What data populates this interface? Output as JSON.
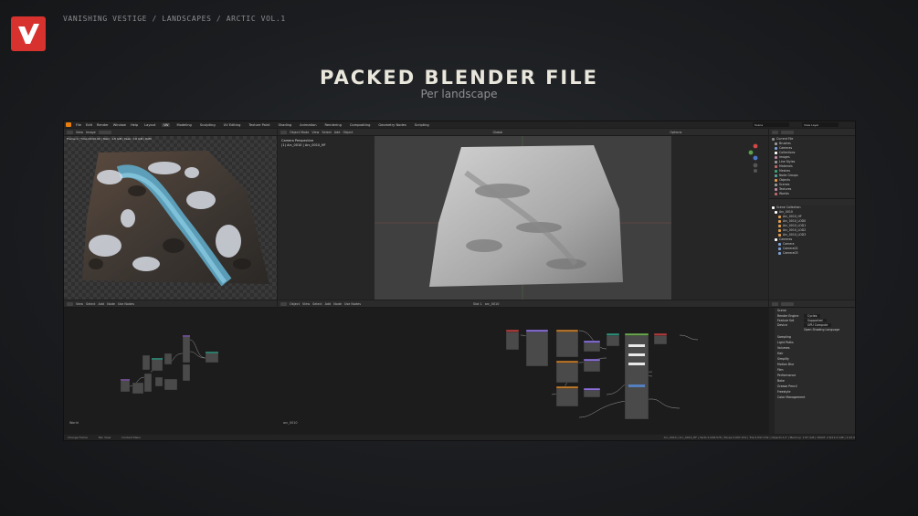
{
  "header": {
    "breadcrumb": "VANISHING VESTIGE / LANDSCAPES / ARCTIC VOL.1",
    "title": "PACKED BLENDER FILE",
    "subtitle": "Per landscape"
  },
  "colors": {
    "brand": "#d8322f",
    "blender_orange": "#e87d0d",
    "node_purple": "#8a6fd8",
    "node_orange": "#c07a2c",
    "node_teal": "#2e8f7a",
    "node_red": "#b33b3b",
    "node_green": "#6aa84f"
  },
  "blender": {
    "workspaces": [
      "Layout",
      "UV",
      "Modeling",
      "Sculpting",
      "UV Editing",
      "Texture Paint",
      "Shading",
      "Animation",
      "Rendering",
      "Compositing",
      "Geometry Nodes",
      "Scripting"
    ],
    "active_workspace": "UV",
    "menu": [
      "File",
      "Edit",
      "Render",
      "Window",
      "Help"
    ],
    "scene": "Scene",
    "view_layer": "View Layer",
    "image_editor": {
      "mode": "View",
      "image": "Image",
      "info": "Frame:1 | Time:00:00.00 | Mem: 1.8 GiB | Peak: 1.8 GiB | RAM"
    },
    "viewport": {
      "mode": "Object Mode",
      "menus": [
        "View",
        "Select",
        "Add",
        "Object"
      ],
      "orientation": "Global",
      "overlay_text": "Camera Perspective",
      "object_text": "(1) Arc_0010 | Arc_0010_HF",
      "options": "Options"
    },
    "outliner": {
      "title": "Current File",
      "items": [
        "Brushes",
        "Cameras",
        "Collections",
        "Images",
        "Line Styles",
        "Materials",
        "Meshes",
        "Node Groups",
        "Objects",
        "Scenes",
        "Textures",
        "Worlds"
      ],
      "scene_collection": "Scene Collection",
      "objects": [
        "Arc_0010",
        "Arc_0010_HF",
        "Arc_0010_LOD0",
        "Arc_0010_LOD1",
        "Arc_0010_LOD2",
        "Arc_0010_LOD3",
        "Cameras",
        "Camera",
        "Camera02",
        "Camera03"
      ]
    },
    "node_editor_left": {
      "menus": [
        "View",
        "Select",
        "Add",
        "Node"
      ],
      "use_nodes": "Use Nodes",
      "label": "World"
    },
    "node_editor_right": {
      "menus": [
        "Object",
        "View",
        "Select",
        "Add",
        "Node"
      ],
      "use_nodes": "Use Nodes",
      "slot": "Slot 1",
      "material": "arc_0010",
      "label": "arc_0010"
    },
    "properties": {
      "context": "Scene",
      "render_engine_label": "Render Engine",
      "render_engine": "Cycles",
      "feature_set_label": "Feature Set",
      "feature_set": "Supported",
      "device_label": "Device",
      "device": "GPU Compute",
      "open_shading_language": "Open Shading Language",
      "sections": [
        "Sampling",
        "Light Paths",
        "Volumes",
        "Hair",
        "Simplify",
        "Motion Blur",
        "Film",
        "Performance",
        "Bake",
        "Grease Pencil",
        "Freestyle",
        "Color Management"
      ]
    },
    "statusbar": {
      "left": [
        "Change Frame",
        "Pan View",
        "Context Menu"
      ],
      "right": "Arc_0010 | Arc_0010_HF | Verts:1,048,576 | Faces:2,097,152 | Tris:2,097,152 | Objects:1/7 | Memory: 1.87 GiB | VRAM: 2.8/12.0 GiB | 2.93.0"
    }
  }
}
